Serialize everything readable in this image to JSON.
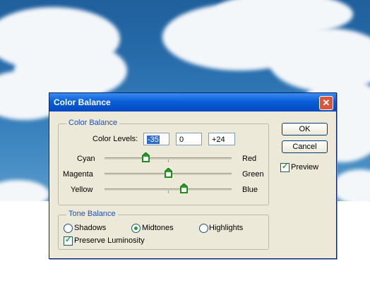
{
  "dialog": {
    "title": "Color Balance",
    "close_glyph": "✕",
    "color_balance_group": "Color Balance",
    "color_levels_label": "Color Levels:",
    "levels": [
      "-35",
      "0",
      "+24"
    ],
    "sliders": [
      {
        "left": "Cyan",
        "right": "Red",
        "value": -35
      },
      {
        "left": "Magenta",
        "right": "Green",
        "value": 0
      },
      {
        "left": "Yellow",
        "right": "Blue",
        "value": 24
      }
    ],
    "tone_group": "Tone Balance",
    "tones": [
      "Shadows",
      "Midtones",
      "Highlights"
    ],
    "selected_tone": "Midtones",
    "preserve_luminosity": "Preserve Luminosity",
    "buttons": {
      "ok": "OK",
      "cancel": "Cancel"
    },
    "preview": "Preview",
    "check_glyph": "✓"
  },
  "colors": {
    "title_bar": "#0a5fd8",
    "dialog_bg": "#ece9d8",
    "group_label": "#1c4fb7",
    "selection": "#3169c6",
    "close_button": "#d8573a",
    "thumb_fill": "#21a121"
  }
}
